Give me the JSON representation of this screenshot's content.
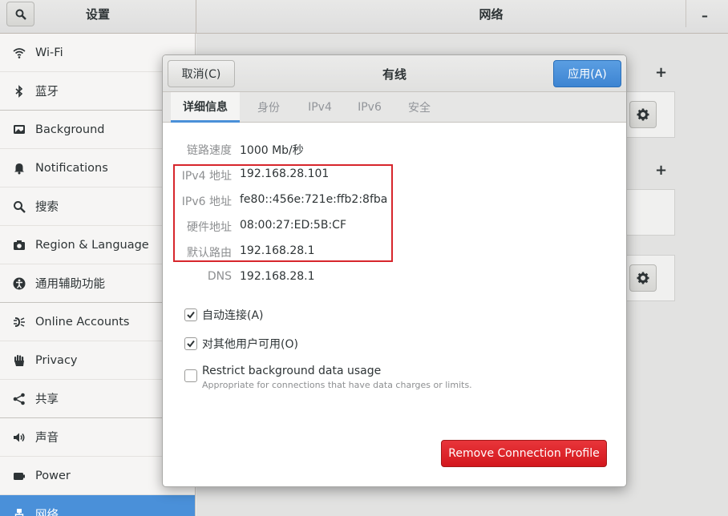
{
  "header": {
    "left_title": "设置",
    "right_title": "网络",
    "minimize_label": "–"
  },
  "sidebar": {
    "items": [
      {
        "label": "Wi-Fi",
        "icon": "wifi-icon"
      },
      {
        "label": "蓝牙",
        "icon": "bluetooth-icon"
      },
      {
        "label": "Background",
        "icon": "background-icon"
      },
      {
        "label": "Notifications",
        "icon": "bell-icon"
      },
      {
        "label": "搜索",
        "icon": "search-icon"
      },
      {
        "label": "Region & Language",
        "icon": "camera-icon"
      },
      {
        "label": "通用辅助功能",
        "icon": "accessibility-icon"
      },
      {
        "label": "Online Accounts",
        "icon": "online-accounts-icon"
      },
      {
        "label": "Privacy",
        "icon": "hand-icon"
      },
      {
        "label": "共享",
        "icon": "share-icon"
      },
      {
        "label": "声音",
        "icon": "speaker-icon"
      },
      {
        "label": "Power",
        "icon": "power-icon"
      },
      {
        "label": "网络",
        "icon": "network-icon"
      }
    ]
  },
  "main": {
    "plus_label": "+"
  },
  "dialog": {
    "cancel_label": "取消(C)",
    "title": "有线",
    "apply_label": "应用(A)",
    "tabs": [
      "详细信息",
      "身份",
      "IPv4",
      "IPv6",
      "安全"
    ],
    "details": [
      {
        "label": "链路速度",
        "value": "1000 Mb/秒"
      },
      {
        "label": "IPv4 地址",
        "value": "192.168.28.101"
      },
      {
        "label": "IPv6 地址",
        "value": "fe80::456e:721e:ffb2:8fba"
      },
      {
        "label": "硬件地址",
        "value": "08:00:27:ED:5B:CF"
      },
      {
        "label": "默认路由",
        "value": "192.168.28.1"
      },
      {
        "label": "DNS",
        "value": "192.168.28.1"
      }
    ],
    "auto_connect_label": "自动连接(A)",
    "auto_connect_checked": true,
    "all_users_label": "对其他用户可用(O)",
    "all_users_checked": true,
    "restrict_label": "Restrict background data usage",
    "restrict_sub": "Appropriate for connections that have data charges or limits.",
    "restrict_checked": false,
    "remove_label": "Remove Connection Profile"
  },
  "colors": {
    "accent": "#4a90d9",
    "destructive": "#d3171d",
    "highlight_box": "#d7262c"
  }
}
